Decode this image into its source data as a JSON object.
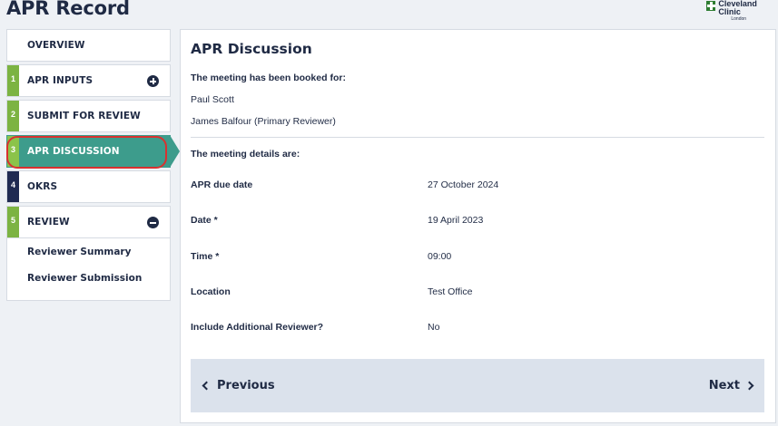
{
  "page": {
    "title": "APR Record"
  },
  "logo": {
    "name": "Cleveland Clinic",
    "sub": "London"
  },
  "sidebar": {
    "overview": "OVERVIEW",
    "items": [
      {
        "num": "1",
        "label": "APR INPUTS",
        "color": "#7cb342"
      },
      {
        "num": "2",
        "label": "SUBMIT FOR REVIEW",
        "color": "#7cb342"
      },
      {
        "num": "3",
        "label": "APR DISCUSSION",
        "color": "#8bc34a"
      },
      {
        "num": "4",
        "label": "OKRS",
        "color": "#1f2a52"
      },
      {
        "num": "5",
        "label": "REVIEW",
        "color": "#7cb342"
      }
    ],
    "review_subitems": [
      "Reviewer Summary",
      "Reviewer Submission"
    ]
  },
  "main": {
    "title": "APR Discussion",
    "booked_heading": "The meeting has been booked for:",
    "attendees": [
      "Paul Scott",
      "James Balfour (Primary Reviewer)"
    ],
    "details_heading": "The meeting details are:",
    "details": [
      {
        "label": "APR due date",
        "value": "27 October 2024"
      },
      {
        "label": "Date *",
        "value": "19 April 2023"
      },
      {
        "label": "Time *",
        "value": "09:00"
      },
      {
        "label": "Location",
        "value": "Test Office"
      },
      {
        "label": "Include Additional Reviewer?",
        "value": "No"
      }
    ]
  },
  "footer": {
    "previous": "Previous",
    "next": "Next"
  },
  "colors": {
    "accent": "#3d9c8c",
    "highlight": "#d9312f",
    "navy": "#1f2a44"
  }
}
